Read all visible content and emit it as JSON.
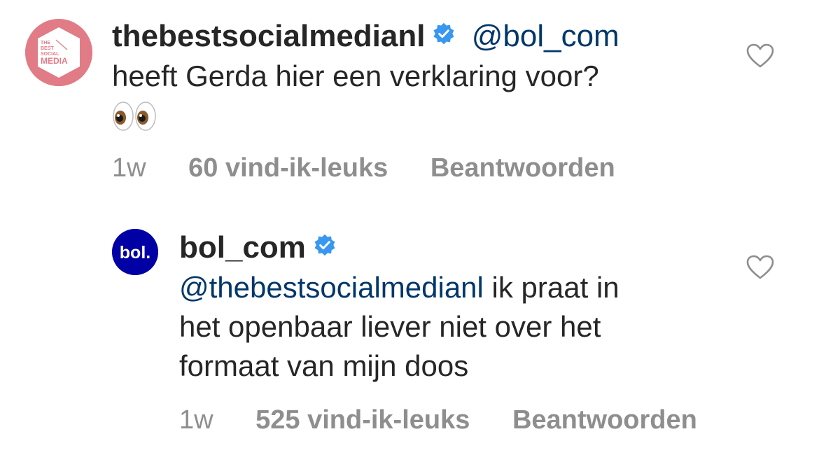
{
  "comments": [
    {
      "username": "thebestsocialmedianl",
      "verified": true,
      "mention": "@bol_com",
      "text": "heeft Gerda hier een verklaring voor?",
      "emoji": "👀",
      "time": "1w",
      "likes": "60 vind-ik-leuks",
      "reply_label": "Beantwoorden",
      "avatar_text": [
        "THE",
        "BEST",
        "SOCIAL",
        "MEDIA"
      ],
      "avatar_color": "#e17b86"
    },
    {
      "username": "bol_com",
      "verified": true,
      "mention": "@thebestsocialmedianl",
      "text_lines": [
        " ik praat in",
        "het openbaar liever niet over het",
        "formaat van mijn doos"
      ],
      "time": "1w",
      "likes": "525 vind-ik-leuks",
      "reply_label": "Beantwoorden",
      "avatar_text": "bol.",
      "avatar_color": "#0000a4"
    }
  ],
  "colors": {
    "text": "#262626",
    "meta": "#8e8e8e",
    "mention": "#00376b",
    "verified": "#3897f0"
  },
  "icons": {
    "verified": "verified-badge-icon",
    "like": "heart-outline-icon",
    "emoji": "eyes-emoji"
  }
}
